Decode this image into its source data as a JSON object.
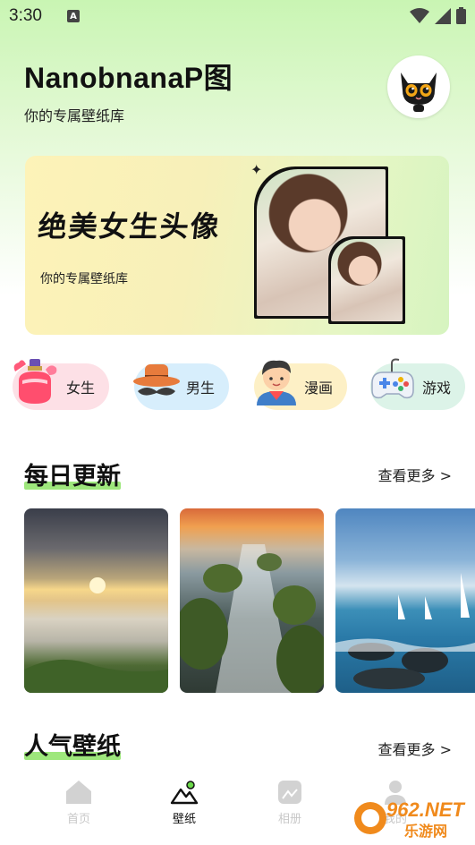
{
  "status_bar": {
    "time": "3:30",
    "notification_badge": "A"
  },
  "header": {
    "title": "NanobnanaP图",
    "subtitle": "你的专属壁纸库"
  },
  "banner": {
    "title": "绝美女生头像",
    "subtitle": "你的专属壁纸库"
  },
  "categories": [
    {
      "label": "女生",
      "icon": "perfume-bottle-icon",
      "bg": "#fde0e6"
    },
    {
      "label": "男生",
      "icon": "hat-mustache-icon",
      "bg": "#d7eefc"
    },
    {
      "label": "漫画",
      "icon": "cartoon-boy-icon",
      "bg": "#fdf0c6"
    },
    {
      "label": "游戏",
      "icon": "gamepad-icon",
      "bg": "#dcf3e8"
    }
  ],
  "daily_update": {
    "title": "每日更新",
    "see_more": "查看更多 >"
  },
  "popular": {
    "title": "人气壁纸",
    "see_more": "查看更多 >"
  },
  "bottom_nav": [
    {
      "label": "首页",
      "icon": "home-icon",
      "active": false
    },
    {
      "label": "壁纸",
      "icon": "mountain-picture-icon",
      "active": true
    },
    {
      "label": "相册",
      "icon": "album-icon",
      "active": false
    },
    {
      "label": "我的",
      "icon": "person-icon",
      "active": false
    }
  ],
  "watermark": {
    "text": "962.NET",
    "subtext": "乐游网"
  },
  "colors": {
    "accent_green": "#9ee77c",
    "active_nav": "#111111",
    "inactive_nav": "#c8c8c8"
  }
}
